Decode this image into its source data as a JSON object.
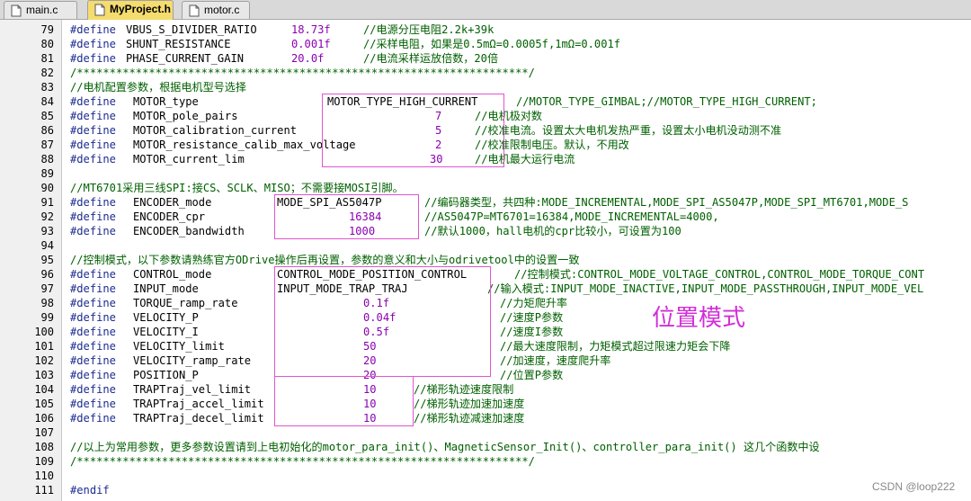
{
  "tabs": [
    {
      "label": "main.c",
      "active": false
    },
    {
      "label": "MyProject.h",
      "active": true
    },
    {
      "label": "motor.c",
      "active": false
    }
  ],
  "lines": [
    {
      "n": "79",
      "kw": "#define",
      "name": "VBUS_S_DIVIDER_RATIO",
      "value": "18.73f",
      "comment": "//电源分压电阻2.2k+39k"
    },
    {
      "n": "80",
      "kw": "#define",
      "name": "SHUNT_RESISTANCE",
      "value": "0.001f",
      "comment": "//采样电阻，如果是0.5mΩ=0.0005f,1mΩ=0.001f"
    },
    {
      "n": "81",
      "kw": "#define",
      "name": "PHASE_CURRENT_GAIN",
      "value": "20.0f",
      "comment": "//电流采样运放倍数，20倍"
    },
    {
      "n": "82",
      "comment": "/*********************************************************************/"
    },
    {
      "n": "83",
      "comment": "//电机配置参数，根据电机型号选择"
    },
    {
      "n": "84",
      "kw": "#define",
      "name": "MOTOR_type",
      "value": "MOTOR_TYPE_HIGH_CURRENT",
      "comment": "//MOTOR_TYPE_GIMBAL;//MOTOR_TYPE_HIGH_CURRENT;"
    },
    {
      "n": "85",
      "kw": "#define",
      "name": "MOTOR_pole_pairs",
      "value": "7",
      "comment": "//电机极对数"
    },
    {
      "n": "86",
      "kw": "#define",
      "name": "MOTOR_calibration_current",
      "value": "5",
      "comment": "//校准电流。设置太大电机发热严重，设置太小电机没动测不准"
    },
    {
      "n": "87",
      "kw": "#define",
      "name": "MOTOR_resistance_calib_max_voltage",
      "value": "2",
      "comment": "//校准限制电压。默认，不用改"
    },
    {
      "n": "88",
      "kw": "#define",
      "name": "MOTOR_current_lim",
      "value": "30",
      "comment": "//电机最大运行电流"
    },
    {
      "n": "89"
    },
    {
      "n": "90",
      "comment": "//MT6701采用三线SPI:接CS、SCLK、MISO；不需要接MOSI引脚。"
    },
    {
      "n": "91",
      "kw": "#define",
      "name": "ENCODER_mode",
      "value": "MODE_SPI_AS5047P",
      "comment": "//编码器类型，共四种:MODE_INCREMENTAL,MODE_SPI_AS5047P,MODE_SPI_MT6701,MODE_S"
    },
    {
      "n": "92",
      "kw": "#define",
      "name": "ENCODER_cpr",
      "value": "16384",
      "comment": "//AS5047P=MT6701=16384,MODE_INCREMENTAL=4000,"
    },
    {
      "n": "93",
      "kw": "#define",
      "name": "ENCODER_bandwidth",
      "value": "1000",
      "comment": "//默认1000，hall电机的cpr比较小，可设置为100"
    },
    {
      "n": "94"
    },
    {
      "n": "95",
      "comment": "//控制模式，以下参数请熟练官方ODrive操作后再设置，参数的意义和大小与odrivetool中的设置一致"
    },
    {
      "n": "96",
      "kw": "#define",
      "name": "CONTROL_mode",
      "value": "CONTROL_MODE_POSITION_CONTROL",
      "comment": "//控制模式:CONTROL_MODE_VOLTAGE_CONTROL,CONTROL_MODE_TORQUE_CONT"
    },
    {
      "n": "97",
      "kw": "#define",
      "name": "INPUT_mode",
      "value": "INPUT_MODE_TRAP_TRAJ",
      "comment": "//输入模式:INPUT_MODE_INACTIVE,INPUT_MODE_PASSTHROUGH,INPUT_MODE_VEL"
    },
    {
      "n": "98",
      "kw": "#define",
      "name": "TORQUE_ramp_rate",
      "value": "0.1f",
      "comment": "//力矩爬升率"
    },
    {
      "n": "99",
      "kw": "#define",
      "name": "VELOCITY_P",
      "value": "0.04f",
      "comment": "//速度P参数"
    },
    {
      "n": "100",
      "kw": "#define",
      "name": "VELOCITY_I",
      "value": "0.5f",
      "comment": "//速度I参数"
    },
    {
      "n": "101",
      "kw": "#define",
      "name": "VELOCITY_limit",
      "value": "50",
      "comment": "//最大速度限制，力矩模式超过限速力矩会下降"
    },
    {
      "n": "102",
      "kw": "#define",
      "name": "VELOCITY_ramp_rate",
      "value": "20",
      "comment": "//加速度，速度爬升率"
    },
    {
      "n": "103",
      "kw": "#define",
      "name": "POSITION_P",
      "value": "20",
      "comment": "//位置P参数"
    },
    {
      "n": "104",
      "kw": "#define",
      "name": "TRAPTraj_vel_limit",
      "value": "10",
      "comment": "//梯形轨迹速度限制"
    },
    {
      "n": "105",
      "kw": "#define",
      "name": "TRAPTraj_accel_limit",
      "value": "10",
      "comment": "//梯形轨迹加速加速度"
    },
    {
      "n": "106",
      "kw": "#define",
      "name": "TRAPTraj_decel_limit",
      "value": "10",
      "comment": "//梯形轨迹减速加速度"
    },
    {
      "n": "107"
    },
    {
      "n": "108",
      "comment": "//以上为常用参数，更多参数设置请到上电初始化的motor_para_init()、MagneticSensor_Init()、controller_para_init() 这几个函数中设"
    },
    {
      "n": "109",
      "comment": "/*********************************************************************/"
    },
    {
      "n": "110"
    },
    {
      "n": "111",
      "kw": "#endif"
    }
  ],
  "annotation": "位置模式",
  "watermark": "CSDN @loop222",
  "colors": {
    "keyword": "#1d2b8f",
    "comment": "#006000",
    "number": "#8a00b0",
    "highlight_box": "#e055d0",
    "annotation": "#d22fd8",
    "active_tab": "#f5dc6e"
  }
}
